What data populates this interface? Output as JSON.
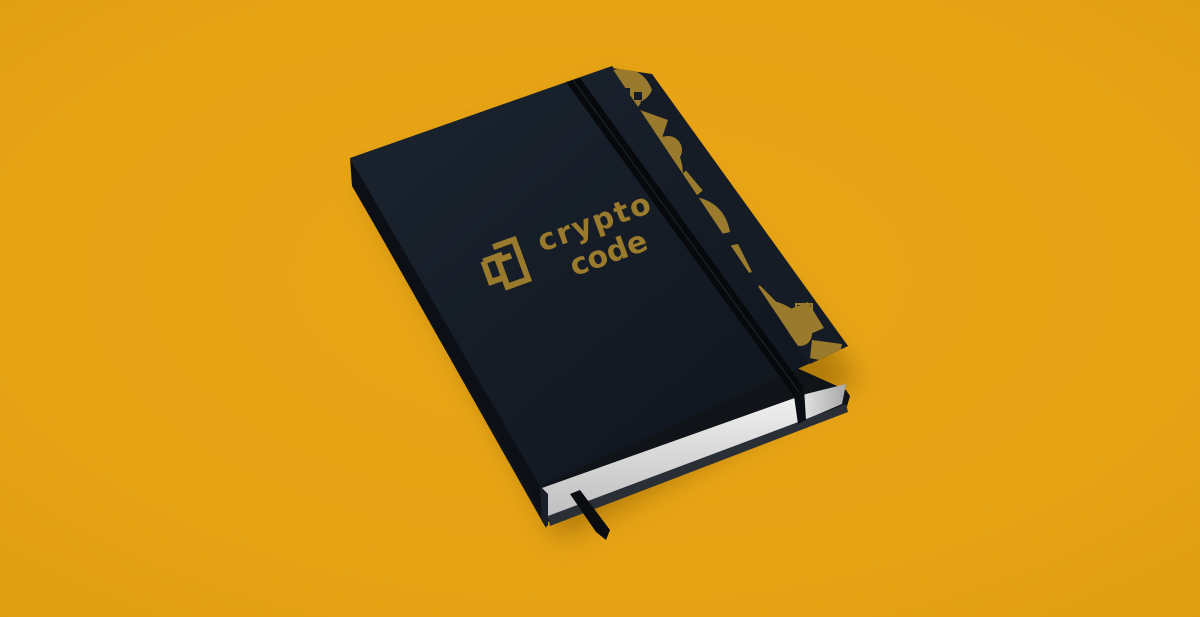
{
  "scene": {
    "description_free": true,
    "background_color": "#E9A412",
    "notebook_cover_color": "#141B24",
    "accent_color": "#9A7A2C",
    "pages_color": "#D8D8D8"
  },
  "logo": {
    "line1": "crypto",
    "line2": "code",
    "icon": "interlocking-squares-icon"
  }
}
